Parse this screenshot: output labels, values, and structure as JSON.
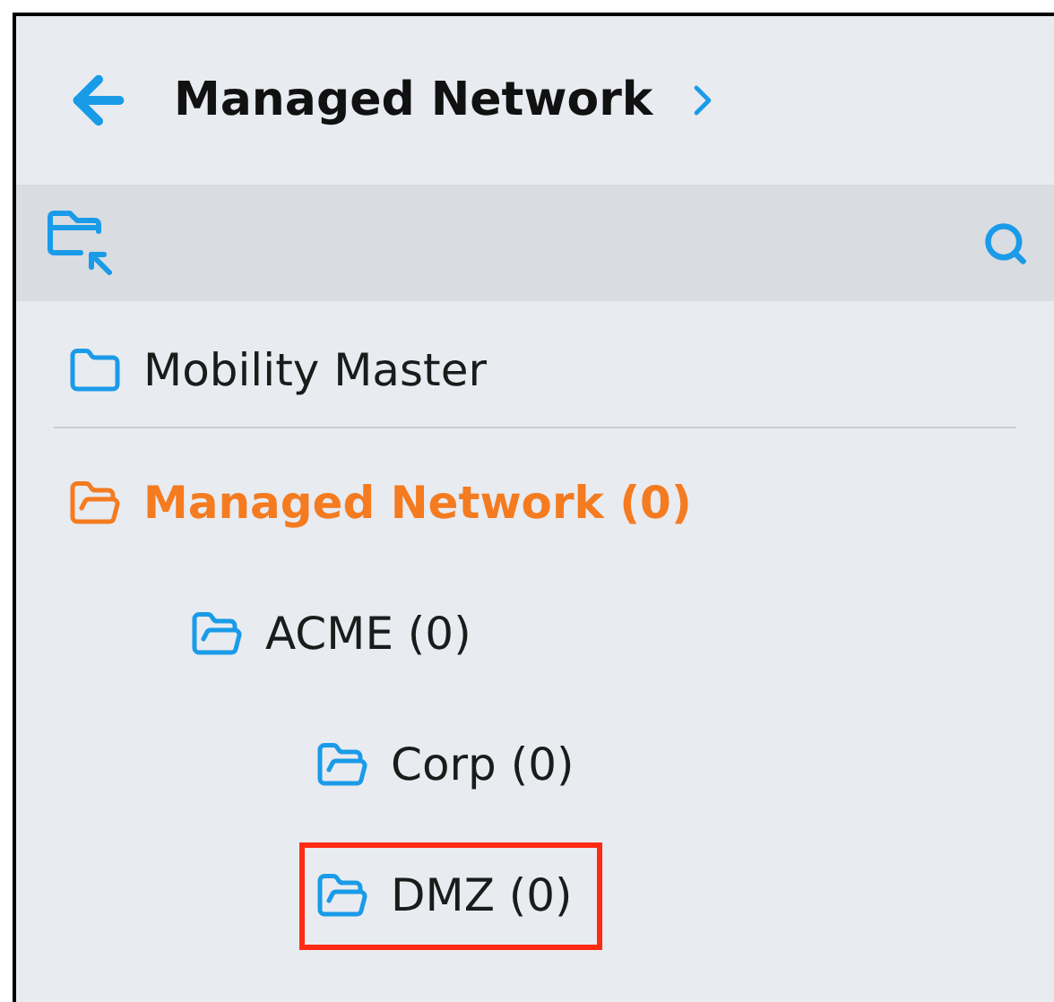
{
  "header": {
    "title": "Managed Network"
  },
  "tree": [
    {
      "label": "Mobility Master",
      "kind": "root",
      "selected": false,
      "highlighted": false
    },
    {
      "label": "Managed Network (0)",
      "kind": "group",
      "selected": true,
      "highlighted": false,
      "children": [
        {
          "label": "ACME (0)",
          "kind": "group",
          "selected": false,
          "highlighted": false,
          "children": [
            {
              "label": "Corp (0)",
              "kind": "group",
              "selected": false,
              "highlighted": false
            },
            {
              "label": "DMZ (0)",
              "kind": "group",
              "selected": false,
              "highlighted": true
            }
          ]
        }
      ]
    }
  ]
}
